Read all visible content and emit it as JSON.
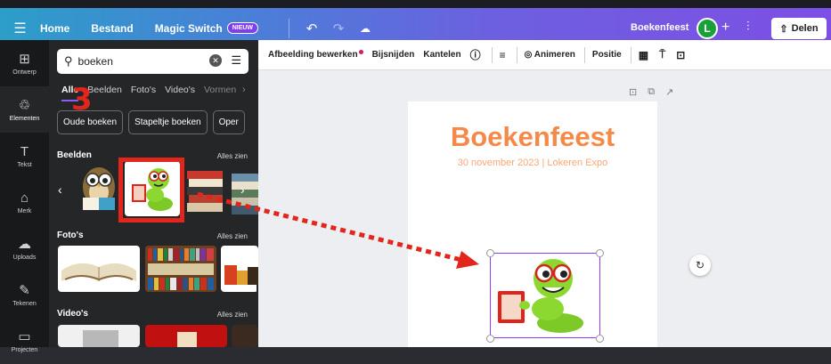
{
  "topbar": {
    "home": "Home",
    "file": "Bestand",
    "magic_switch": "Magic Switch",
    "badge": "NIEUW",
    "doc_title": "Boekenfeest",
    "avatar_initial": "L",
    "share": "Delen"
  },
  "rail": {
    "items": [
      {
        "label": "Ontwerp",
        "icon": "⊞"
      },
      {
        "label": "Elementen",
        "icon": "♲"
      },
      {
        "label": "Tekst",
        "icon": "T"
      },
      {
        "label": "Merk",
        "icon": "⌂"
      },
      {
        "label": "Uploads",
        "icon": "☁"
      },
      {
        "label": "Tekenen",
        "icon": "✎"
      },
      {
        "label": "Projecten",
        "icon": "▭"
      }
    ]
  },
  "panel": {
    "search_value": "boeken",
    "tabs": [
      "Alle",
      "Beelden",
      "Foto's",
      "Video's",
      "Vormen"
    ],
    "chips": [
      "Oude boeken",
      "Stapeltje boeken",
      "Oper"
    ],
    "annotation_number": "3",
    "section_images": "Beelden",
    "section_photos": "Foto's",
    "section_videos": "Video's",
    "see_all": "Alles zien"
  },
  "context_toolbar": {
    "edit_image": "Afbeelding bewerken",
    "crop": "Bijsnijden",
    "flip": "Kantelen",
    "animate": "Animeren",
    "position": "Positie"
  },
  "page": {
    "title": "Boekenfeest",
    "subtitle": "30 november 2023 | Lokeren Expo"
  },
  "colors": {
    "accent": "#8b3dff",
    "title_orange": "#f5894a",
    "annotation_red": "#e3261c"
  }
}
